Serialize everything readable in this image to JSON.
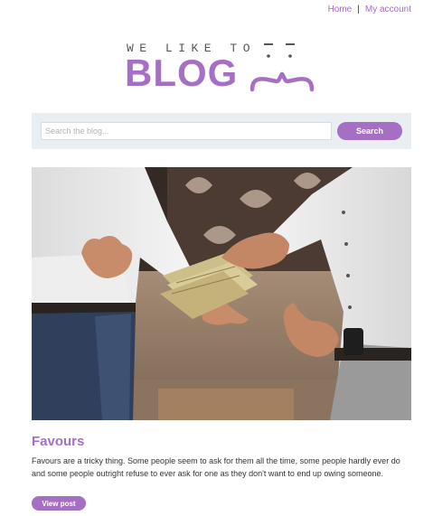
{
  "nav": {
    "home_label": "Home",
    "separator": "|",
    "account_label": "My account",
    "link_color": "#a56fc4"
  },
  "logo": {
    "tagline": "WE LIKE TO",
    "word": "BLOG",
    "face_icon": "smiley-face-icon",
    "brand_color": "#a56fc4"
  },
  "search": {
    "placeholder": "Search the blog...",
    "value": "",
    "button_label": "Search"
  },
  "post": {
    "image_description_icon": "money-exchange-photo",
    "title": "Favours",
    "excerpt": "Favours are a tricky thing. Some people seem to ask for them all the time, some people hardly ever do and some people outright refuse to ever ask for one as they don't want to end up owing someone.",
    "button_label": "View post"
  }
}
